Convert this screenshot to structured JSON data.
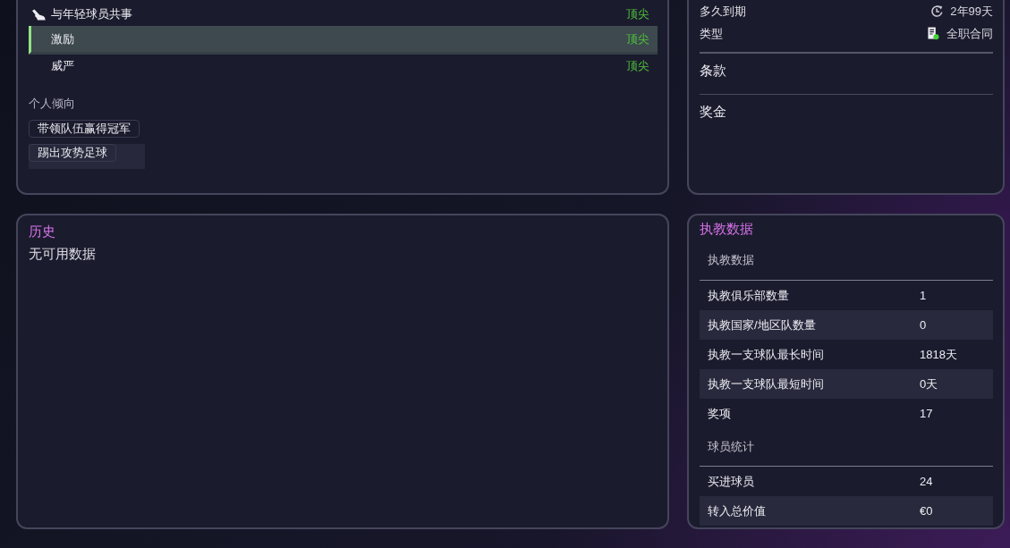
{
  "profile_panel": {
    "attributes": [
      {
        "kind": "icon-row",
        "label": "与年轻球员共事",
        "rating": "顶尖",
        "selected": false
      },
      {
        "kind": "plain",
        "label": "激励",
        "rating": "顶尖",
        "selected": true
      },
      {
        "kind": "plain",
        "label": "威严",
        "rating": "顶尖",
        "selected": false
      }
    ],
    "tendencies": {
      "heading": "个人倾向",
      "tags": [
        {
          "label": "带领队伍赢得冠军",
          "selected": false
        },
        {
          "label": "踢出攻势足球",
          "selected": true
        }
      ]
    }
  },
  "contract_panel": {
    "details": [
      {
        "kind": "clock",
        "label": "多久到期",
        "value": "2年99天"
      },
      {
        "kind": "document",
        "label": "类型",
        "value": "全职合同"
      }
    ],
    "sections": [
      "条款",
      "奖金"
    ]
  },
  "history_panel": {
    "title": "历史",
    "message": "无可用数据"
  },
  "coaching_stats_panel": {
    "title": "执教数据",
    "sections": [
      {
        "heading": "执教数据",
        "rows": [
          {
            "label": "执教俱乐部数量",
            "value": "1"
          },
          {
            "label": "执教国家/地区队数量",
            "value": "0"
          },
          {
            "label": "执教一支球队最长时间",
            "value": "1818天"
          },
          {
            "label": "执教一支球队最短时间",
            "value": "0天"
          },
          {
            "label": "奖项",
            "value": "17"
          }
        ]
      },
      {
        "heading": "球员统计",
        "rows": [
          {
            "label": "买进球员",
            "value": "24"
          },
          {
            "label": "转入总价值",
            "value": "€0"
          }
        ]
      }
    ]
  }
}
